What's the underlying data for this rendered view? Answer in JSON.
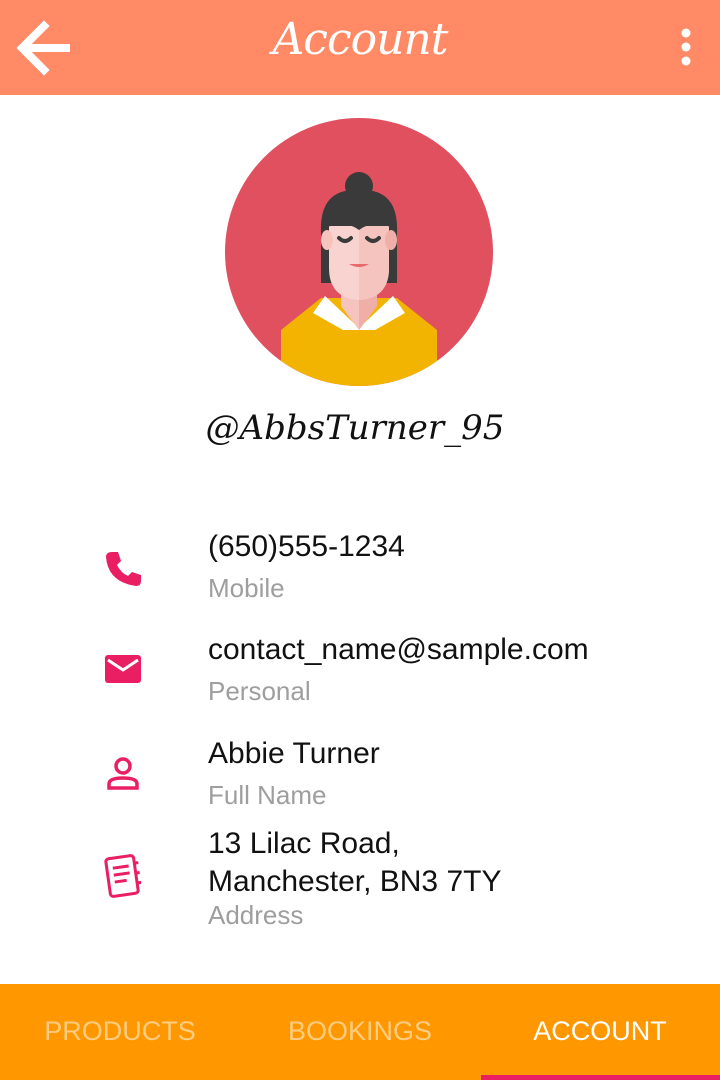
{
  "app_bar": {
    "title": "Account",
    "back_icon": "arrow-left-icon",
    "menu_icon": "more-vert-icon",
    "color": "#FF8A65"
  },
  "profile": {
    "handle": "@AbbsTurner_95",
    "avatar_bg": "#E0505F"
  },
  "details": [
    {
      "icon": "phone-icon",
      "value": "(650)555-1234",
      "label": "Mobile"
    },
    {
      "icon": "email-icon",
      "value": "contact_name@sample.com",
      "label": "Personal"
    },
    {
      "icon": "person-icon",
      "value": "Abbie Turner",
      "label": "Full Name"
    },
    {
      "icon": "address-book-icon",
      "value_line1": "13 Lilac Road,",
      "value_line2": "Manchester, BN3 7TY",
      "label": "Address"
    }
  ],
  "accent_color": "#E91E63",
  "bottom_nav": {
    "tabs": [
      {
        "label": "PRODUCTS",
        "active": false
      },
      {
        "label": "BOOKINGS",
        "active": false
      },
      {
        "label": "ACCOUNT",
        "active": true
      }
    ],
    "color": "#FF9800"
  }
}
